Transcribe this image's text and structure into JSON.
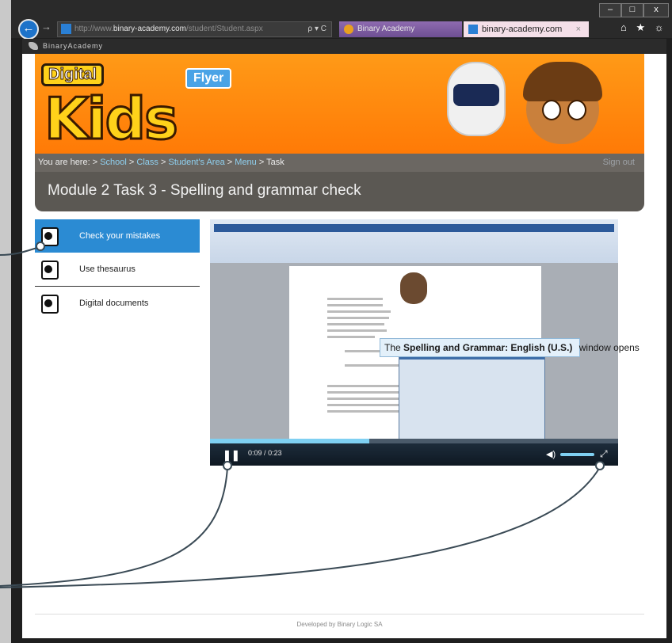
{
  "browser": {
    "url_prefix": "http://www.",
    "url_domain": "binary-academy.com",
    "url_path": "/student/Student.aspx",
    "search_glyph": "ρ ▾ C",
    "tabs": [
      {
        "label": "Binary Academy"
      },
      {
        "label": "binary-academy.com",
        "close": "×"
      }
    ],
    "window_controls": [
      "–",
      "□",
      "x"
    ],
    "toolbar_icons": "⌂ ★ ☼"
  },
  "brand": {
    "name": "BinaryAcademy"
  },
  "banner": {
    "digital": "Digital",
    "flyer": "Flyer",
    "kids": "Kids"
  },
  "breadcrumb": {
    "prefix": "You are here:",
    "items": [
      "School",
      "Class",
      "Student's Area",
      "Menu"
    ],
    "separator": ">",
    "current": "Task",
    "signout": "Sign out"
  },
  "module": {
    "title": "Module 2 Task 3 - Spelling and grammar check"
  },
  "menu": {
    "items": [
      {
        "label": "Check your mistakes",
        "active": true
      },
      {
        "label": "Use thesaurus",
        "active": false
      },
      {
        "label": "Digital documents",
        "active": false
      }
    ]
  },
  "video": {
    "tooltip_bold": "Spelling and Grammar: English (U.S.)",
    "tooltip_pre": "The",
    "tooltip_post": "window opens",
    "time_current": "0:09",
    "time_sep": "/",
    "time_total": "0:23",
    "pause_glyph": "❚❚",
    "volume_glyph": "◀)",
    "fullscreen_glyph": "⤢",
    "progress": 0.39,
    "volume_level": 0.85
  },
  "footer": {
    "text": "Developed by Binary Logic SA"
  },
  "colors": {
    "accent": "#2b8bd3",
    "banner": "#ff8a0f",
    "breadcrumb": "#6b6762"
  }
}
